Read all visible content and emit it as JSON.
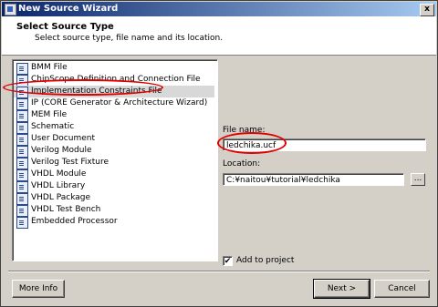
{
  "window": {
    "title": "New Source Wizard",
    "close_glyph": "x"
  },
  "header": {
    "title": "Select Source Type",
    "subtitle": "Select source type, file name and its location."
  },
  "source_types": [
    {
      "label": "BMM File",
      "icon": "bmm-file-icon"
    },
    {
      "label": "ChipScope Definition and Connection File",
      "icon": "chipscope-icon"
    },
    {
      "label": "Implementation Constraints File",
      "icon": "constraints-file-icon",
      "selected": true
    },
    {
      "label": "IP (CORE Generator & Architecture Wizard)",
      "icon": "ip-core-icon"
    },
    {
      "label": "MEM File",
      "icon": "mem-file-icon"
    },
    {
      "label": "Schematic",
      "icon": "schematic-icon"
    },
    {
      "label": "User Document",
      "icon": "user-document-icon"
    },
    {
      "label": "Verilog Module",
      "icon": "verilog-module-icon"
    },
    {
      "label": "Verilog Test Fixture",
      "icon": "verilog-test-fixture-icon"
    },
    {
      "label": "VHDL Module",
      "icon": "vhdl-module-icon"
    },
    {
      "label": "VHDL Library",
      "icon": "vhdl-library-icon"
    },
    {
      "label": "VHDL Package",
      "icon": "vhdl-package-icon"
    },
    {
      "label": "VHDL Test Bench",
      "icon": "vhdl-test-bench-icon"
    },
    {
      "label": "Embedded Processor",
      "icon": "embedded-processor-icon"
    }
  ],
  "file_name": {
    "label": "File name:",
    "value": "ledchika.ucf"
  },
  "location": {
    "label": "Location:",
    "value": "C:¥naitou¥tutorial¥ledchika",
    "browse_label": "..."
  },
  "add_to_project": {
    "label": "Add to project",
    "checked": true,
    "check_glyph": "✔"
  },
  "buttons": {
    "more_info": "More Info",
    "next": "Next >",
    "cancel": "Cancel"
  },
  "colors": {
    "title_start": "#0a246a",
    "title_end": "#a6caf0",
    "highlight_oval": "#e00000",
    "selected_row": "#d8d8d8"
  }
}
